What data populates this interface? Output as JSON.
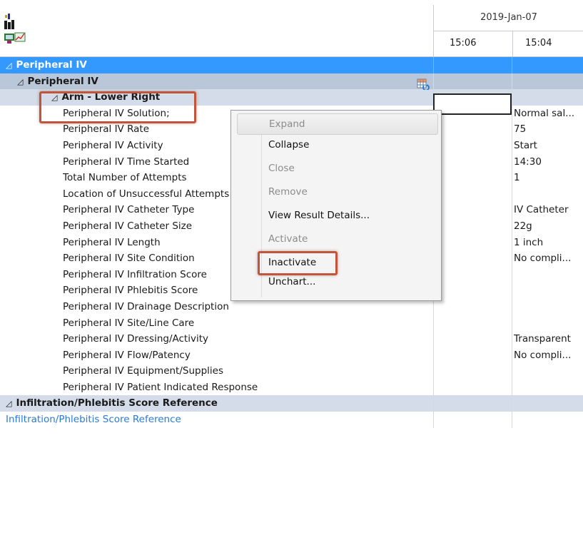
{
  "header": {
    "date": "2019-Jan-07",
    "times": [
      "15:06",
      "15:04"
    ]
  },
  "sections": {
    "peripheral_iv_top": "Peripheral IV",
    "peripheral_iv_sub": "Peripheral IV",
    "arm_lower_right": "Arm - Lower Right",
    "infiltration_ref_header": "Infiltration/Phlebitis Score Reference",
    "infiltration_ref_link": "Infiltration/Phlebitis Score Reference"
  },
  "rows": [
    {
      "label": "Peripheral IV Solution;",
      "value": "Normal sal..."
    },
    {
      "label": "Peripheral IV Rate",
      "value": "75"
    },
    {
      "label": "Peripheral IV Activity",
      "value": "Start"
    },
    {
      "label": "Peripheral IV Time Started",
      "value": "14:30"
    },
    {
      "label": "Total Number of Attempts",
      "value": "1"
    },
    {
      "label": "Location of Unsuccessful Attempts",
      "value": ""
    },
    {
      "label": "Peripheral IV Catheter Type",
      "value": "IV Catheter"
    },
    {
      "label": "Peripheral IV Catheter Size",
      "value": "22g"
    },
    {
      "label": "Peripheral IV Length",
      "value": "1 inch"
    },
    {
      "label": "Peripheral IV Site Condition",
      "value": "No compli..."
    },
    {
      "label": "Peripheral IV Infiltration Score",
      "value": ""
    },
    {
      "label": "Peripheral IV Phlebitis Score",
      "value": ""
    },
    {
      "label": "Peripheral IV Drainage Description",
      "value": ""
    },
    {
      "label": "Peripheral IV Site/Line Care",
      "value": ""
    },
    {
      "label": "Peripheral IV Dressing/Activity",
      "value": "Transparent"
    },
    {
      "label": "Peripheral IV Flow/Patency",
      "value": "No compli..."
    },
    {
      "label": "Peripheral IV Equipment/Supplies",
      "value": ""
    },
    {
      "label": "Peripheral IV Patient Indicated Response",
      "value": ""
    }
  ],
  "context_menu": {
    "items": [
      {
        "label": "Expand",
        "state": "disabled"
      },
      {
        "label": "Collapse",
        "state": "enabled"
      },
      {
        "label": "Close",
        "state": "disabled"
      },
      {
        "label": "Remove",
        "state": "disabled"
      },
      {
        "label": "View Result Details...",
        "state": "enabled"
      },
      {
        "label": "Activate",
        "state": "disabled"
      },
      {
        "label": "Inactivate",
        "state": "enabled"
      },
      {
        "label": "Unchart...",
        "state": "enabled"
      }
    ]
  },
  "icons": {
    "app": "flowsheet-app-icon",
    "grid": "grid-refresh-icon",
    "collapse": "collapse-triangle-icon"
  },
  "colors": {
    "section_blue": "#3399ff",
    "highlight_red": "#c0553b",
    "link_blue": "#2a7bd6"
  }
}
